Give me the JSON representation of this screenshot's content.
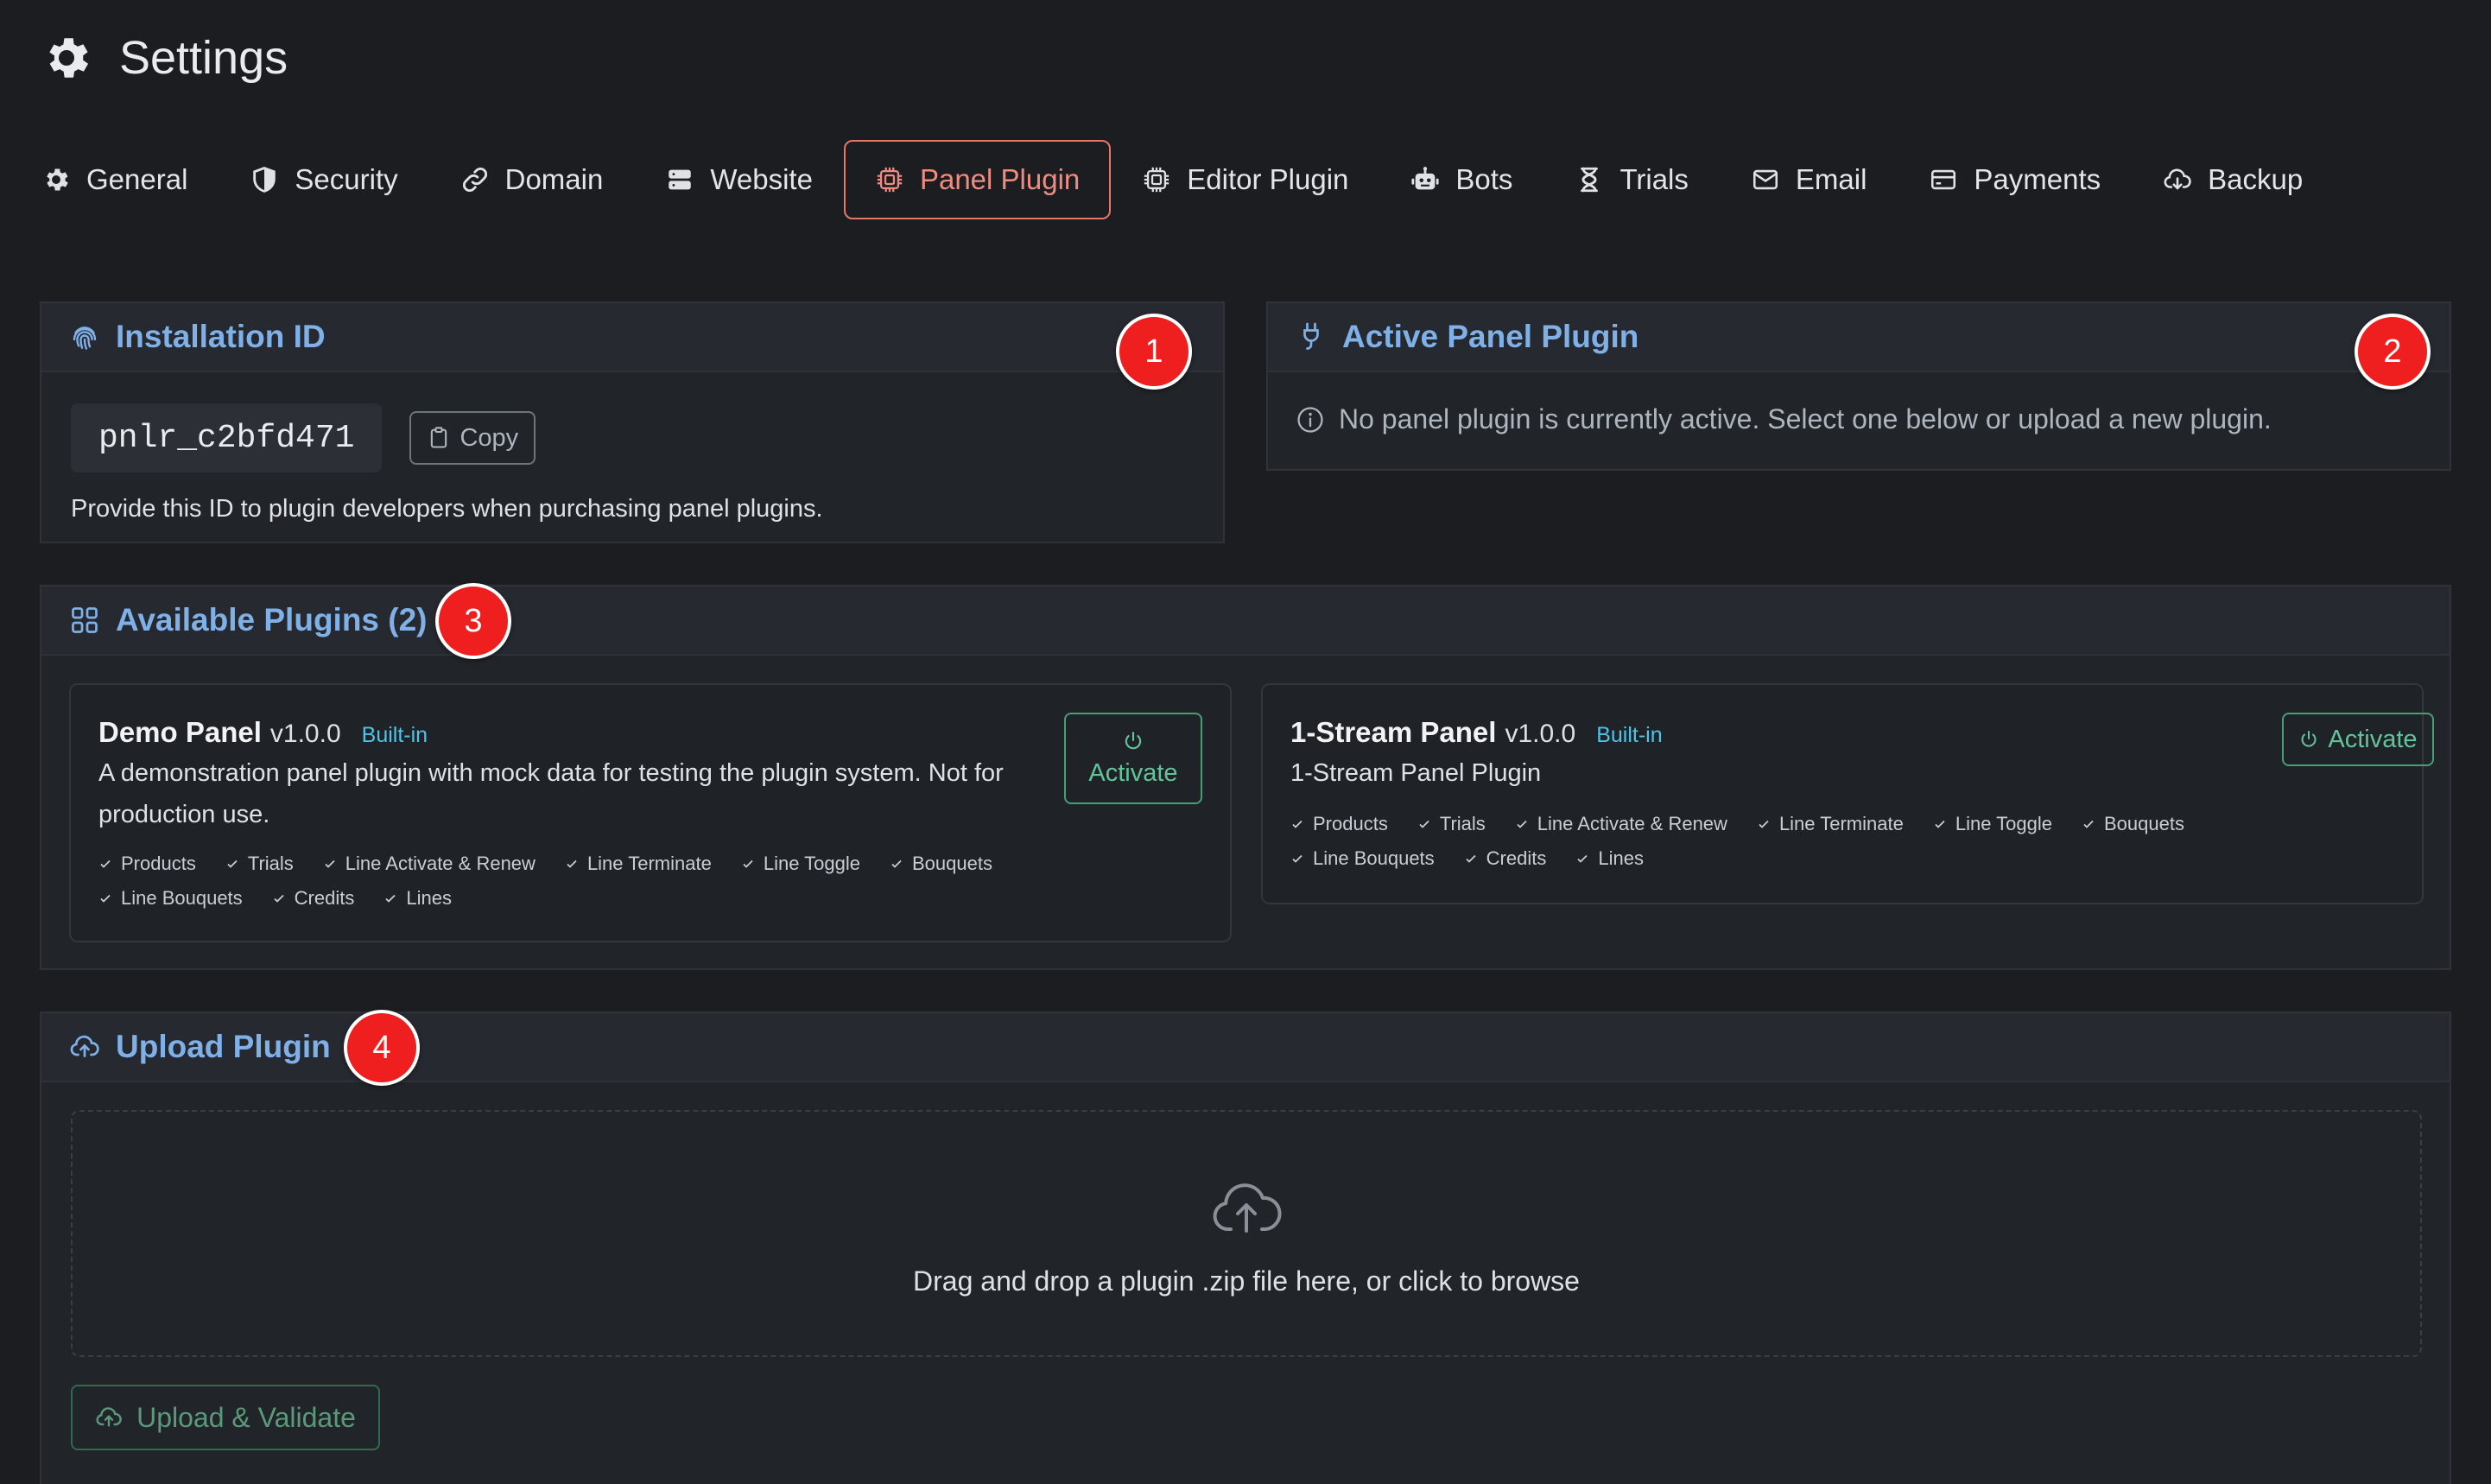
{
  "header": {
    "title": "Settings",
    "icon": "gear-icon"
  },
  "tabs": [
    {
      "label": "General",
      "icon": "gear-icon"
    },
    {
      "label": "Security",
      "icon": "shield-icon"
    },
    {
      "label": "Domain",
      "icon": "link-icon"
    },
    {
      "label": "Website",
      "icon": "server-icon"
    },
    {
      "label": "Panel Plugin",
      "icon": "cpu-icon",
      "active": true
    },
    {
      "label": "Editor Plugin",
      "icon": "cpu-icon"
    },
    {
      "label": "Bots",
      "icon": "robot-icon"
    },
    {
      "label": "Trials",
      "icon": "hourglass-icon"
    },
    {
      "label": "Email",
      "icon": "envelope-icon"
    },
    {
      "label": "Payments",
      "icon": "credit-card-icon"
    },
    {
      "label": "Backup",
      "icon": "cloud-download-icon"
    }
  ],
  "installation": {
    "title": "Installation ID",
    "id_value": "pnlr_c2bfd471",
    "copy_label": "Copy",
    "help": "Provide this ID to plugin developers when purchasing panel plugins.",
    "badge": "1"
  },
  "active_panel": {
    "title": "Active Panel Plugin",
    "message": "No panel plugin is currently active. Select one below or upload a new plugin.",
    "badge": "2"
  },
  "available": {
    "title": "Available Plugins (2)",
    "badge": "3",
    "plugins": [
      {
        "name": "Demo Panel",
        "version": "v1.0.0",
        "tag": "Built-in",
        "description": "A demonstration panel plugin with mock data for testing the plugin system. Not for production use.",
        "features": [
          "Products",
          "Trials",
          "Line Activate & Renew",
          "Line Terminate",
          "Line Toggle",
          "Bouquets",
          "Line Bouquets",
          "Credits",
          "Lines"
        ],
        "button": "Activate"
      },
      {
        "name": "1-Stream Panel",
        "version": "v1.0.0",
        "tag": "Built-in",
        "description": "1-Stream Panel Plugin",
        "features": [
          "Products",
          "Trials",
          "Line Activate & Renew",
          "Line Terminate",
          "Line Toggle",
          "Bouquets",
          "Line Bouquets",
          "Credits",
          "Lines"
        ],
        "button": "Activate"
      }
    ]
  },
  "upload": {
    "title": "Upload Plugin",
    "badge": "4",
    "dropzone_text": "Drag and drop a plugin .zip file here, or click to browse",
    "button": "Upload & Validate"
  },
  "colors": {
    "background": "#1c1d21",
    "accent_active_tab": "#e8756a",
    "card_title": "#7fb0e8",
    "success": "#479f76",
    "badge": "#ef1f20"
  }
}
